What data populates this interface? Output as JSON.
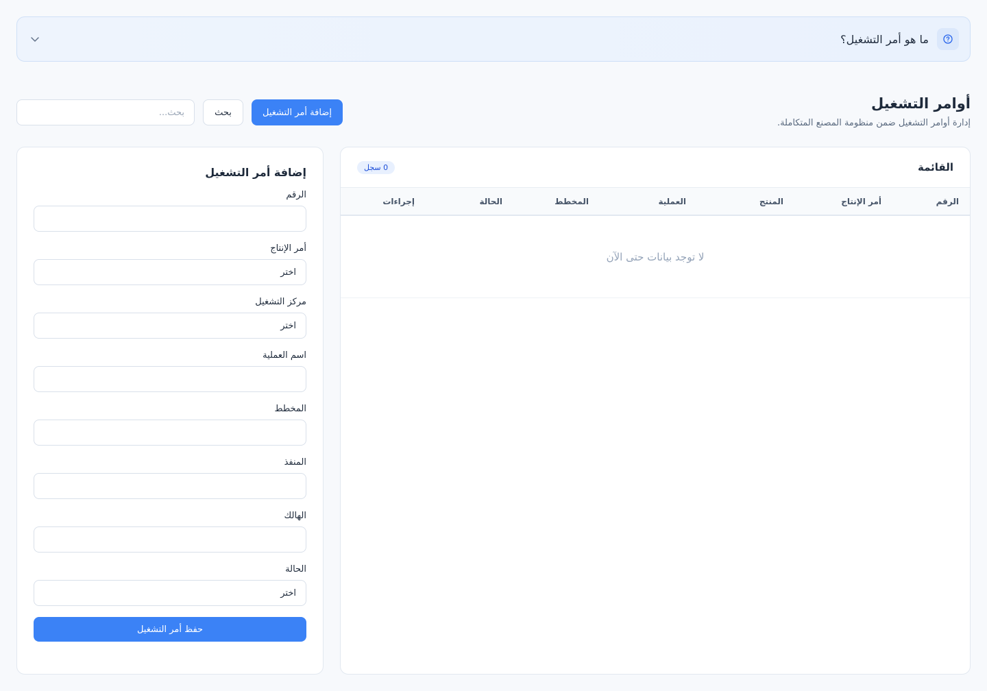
{
  "help": {
    "title": "ما هو أمر التشغيل؟"
  },
  "header": {
    "title": "أوامر التشغيل",
    "subtitle": "إدارة أوامر التشغيل ضمن منظومة المصنع المتكاملة."
  },
  "toolbar": {
    "search_placeholder": "بحث...",
    "search_button": "بحث",
    "add_button": "إضافة أمر التشغيل"
  },
  "list": {
    "title": "القائمة",
    "count_badge": "0 سجل",
    "columns": [
      "الرقم",
      "أمر الإنتاج",
      "المنتج",
      "العملية",
      "المخطط",
      "الحالة",
      "إجراءات"
    ],
    "empty_message": "لا توجد بيانات حتى الآن"
  },
  "form": {
    "title": "إضافة أمر التشغيل",
    "fields": [
      {
        "label": "الرقم",
        "value": ""
      },
      {
        "label": "أمر الإنتاج",
        "value": "اختر"
      },
      {
        "label": "مركز التشغيل",
        "value": "اختر"
      },
      {
        "label": "اسم العملية",
        "value": ""
      },
      {
        "label": "المخطط",
        "value": ""
      },
      {
        "label": "المنفذ",
        "value": ""
      },
      {
        "label": "الهالك",
        "value": ""
      },
      {
        "label": "الحالة",
        "value": "اختر"
      }
    ],
    "save_button": "حفظ أمر التشغيل"
  },
  "colors": {
    "accent": "#3b82f6",
    "background": "#f7f9fc",
    "help_bg": "#eef4fd"
  }
}
